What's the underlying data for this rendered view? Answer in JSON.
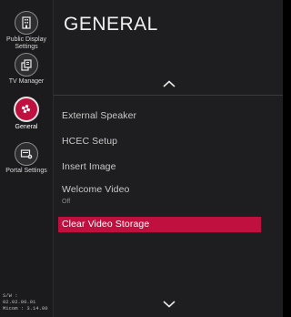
{
  "sidebar": {
    "items": [
      {
        "label_line1": "Public Display",
        "label_line2": "Settings",
        "icon": "building-icon"
      },
      {
        "label_line1": "TV Manager",
        "label_line2": "",
        "icon": "tv-manager-icon"
      },
      {
        "label_line1": "General",
        "label_line2": "",
        "icon": "gear-icon"
      },
      {
        "label_line1": "Portal Settings",
        "label_line2": "",
        "icon": "portal-icon"
      }
    ],
    "version": {
      "sw": "S/W : 02.02.00.01",
      "micom": "Micom : 3.14.00"
    }
  },
  "main": {
    "title": "GENERAL",
    "menu": [
      {
        "label": "External Speaker"
      },
      {
        "label": "HCEC Setup"
      },
      {
        "label": "Insert Image"
      },
      {
        "label": "Welcome Video",
        "sub": "Off"
      },
      {
        "label": "Clear Video Storage",
        "selected": true
      }
    ]
  },
  "colors": {
    "accent": "#bf1040",
    "background": "#1e1e20",
    "sidebar": "#1b1b1d"
  }
}
